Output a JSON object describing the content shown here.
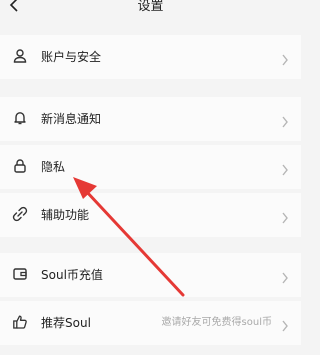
{
  "header": {
    "title": "设置"
  },
  "rows": [
    {
      "label": "账户与安全",
      "icon": "user-icon"
    },
    {
      "label": "新消息通知",
      "icon": "bell-icon"
    },
    {
      "label": "隐私",
      "icon": "lock-icon"
    },
    {
      "label": "辅助功能",
      "icon": "link-icon"
    },
    {
      "label": "Soul币充值",
      "icon": "wallet-icon"
    },
    {
      "label": "推荐Soul",
      "icon": "thumbs-up-icon",
      "hint": "邀请好友可免费得soul币"
    }
  ],
  "colors": {
    "background": "#f4f4f4",
    "annotation_arrow": "#e53935"
  }
}
